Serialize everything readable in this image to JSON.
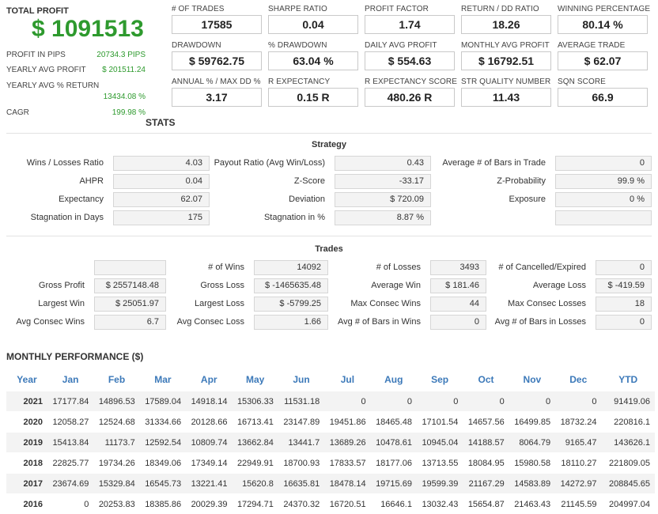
{
  "summary": {
    "total_profit_label": "TOTAL PROFIT",
    "total_profit_value": "$ 1091513",
    "rows": [
      {
        "label": "PROFIT IN PIPS",
        "value": "20734.3 PIPS"
      },
      {
        "label": "YEARLY AVG PROFIT",
        "value": "$ 201511.24"
      },
      {
        "label": "YEARLY AVG % RETURN",
        "value": "13434.08 %"
      },
      {
        "label": "CAGR",
        "value": "199.98 %"
      }
    ]
  },
  "metrics": [
    {
      "label": "# OF TRADES",
      "value": "17585"
    },
    {
      "label": "SHARPE RATIO",
      "value": "0.04"
    },
    {
      "label": "PROFIT FACTOR",
      "value": "1.74"
    },
    {
      "label": "RETURN / DD RATIO",
      "value": "18.26"
    },
    {
      "label": "WINNING PERCENTAGE",
      "value": "80.14 %"
    },
    {
      "label": "DRAWDOWN",
      "value": "$ 59762.75"
    },
    {
      "label": "% DRAWDOWN",
      "value": "63.04 %"
    },
    {
      "label": "DAILY AVG PROFIT",
      "value": "$ 554.63"
    },
    {
      "label": "MONTHLY AVG PROFIT",
      "value": "$ 16792.51"
    },
    {
      "label": "AVERAGE TRADE",
      "value": "$ 62.07"
    },
    {
      "label": "ANNUAL % / MAX DD %",
      "value": "3.17"
    },
    {
      "label": "R EXPECTANCY",
      "value": "0.15 R"
    },
    {
      "label": "R EXPECTANCY SCORE",
      "value": "480.26 R"
    },
    {
      "label": "STR QUALITY NUMBER",
      "value": "11.43"
    },
    {
      "label": "SQN SCORE",
      "value": "66.9"
    }
  ],
  "stats_title": "STATS",
  "strategy": {
    "title": "Strategy",
    "rows": [
      [
        {
          "label": "Wins / Losses Ratio",
          "value": "4.03"
        },
        {
          "label": "Payout Ratio (Avg Win/Loss)",
          "value": "0.43"
        },
        {
          "label": "Average # of Bars in Trade",
          "value": "0"
        }
      ],
      [
        {
          "label": "AHPR",
          "value": "0.04"
        },
        {
          "label": "Z-Score",
          "value": "-33.17"
        },
        {
          "label": "Z-Probability",
          "value": "99.9 %"
        }
      ],
      [
        {
          "label": "Expectancy",
          "value": "62.07"
        },
        {
          "label": "Deviation",
          "value": "$ 720.09"
        },
        {
          "label": "Exposure",
          "value": "0 %"
        }
      ],
      [
        {
          "label": "Stagnation in Days",
          "value": "175"
        },
        {
          "label": "Stagnation in %",
          "value": "8.87 %"
        },
        {
          "label": "",
          "value": ""
        }
      ]
    ]
  },
  "trades": {
    "title": "Trades",
    "rows": [
      [
        {
          "label": "",
          "value": ""
        },
        {
          "label": "# of Wins",
          "value": "14092"
        },
        {
          "label": "# of Losses",
          "value": "3493"
        },
        {
          "label": "# of Cancelled/Expired",
          "value": "0"
        }
      ],
      [
        {
          "label": "Gross Profit",
          "value": "$ 2557148.48"
        },
        {
          "label": "Gross Loss",
          "value": "$ -1465635.48"
        },
        {
          "label": "Average Win",
          "value": "$ 181.46"
        },
        {
          "label": "Average Loss",
          "value": "$ -419.59"
        }
      ],
      [
        {
          "label": "Largest Win",
          "value": "$ 25051.97"
        },
        {
          "label": "Largest Loss",
          "value": "$ -5799.25"
        },
        {
          "label": "Max Consec Wins",
          "value": "44"
        },
        {
          "label": "Max Consec Losses",
          "value": "18"
        }
      ],
      [
        {
          "label": "Avg Consec Wins",
          "value": "6.7"
        },
        {
          "label": "Avg Consec Loss",
          "value": "1.66"
        },
        {
          "label": "Avg # of Bars in Wins",
          "value": "0"
        },
        {
          "label": "Avg # of Bars in Losses",
          "value": "0"
        }
      ]
    ]
  },
  "monthly": {
    "title": "MONTHLY PERFORMANCE ($)",
    "headers": [
      "Year",
      "Jan",
      "Feb",
      "Mar",
      "Apr",
      "May",
      "Jun",
      "Jul",
      "Aug",
      "Sep",
      "Oct",
      "Nov",
      "Dec",
      "YTD"
    ],
    "rows": [
      [
        "2021",
        "17177.84",
        "14896.53",
        "17589.04",
        "14918.14",
        "15306.33",
        "11531.18",
        "0",
        "0",
        "0",
        "0",
        "0",
        "0",
        "91419.06"
      ],
      [
        "2020",
        "12058.27",
        "12524.68",
        "31334.66",
        "20128.66",
        "16713.41",
        "23147.89",
        "19451.86",
        "18465.48",
        "17101.54",
        "14657.56",
        "16499.85",
        "18732.24",
        "220816.1"
      ],
      [
        "2019",
        "15413.84",
        "11173.7",
        "12592.54",
        "10809.74",
        "13662.84",
        "13441.7",
        "13689.26",
        "10478.61",
        "10945.04",
        "14188.57",
        "8064.79",
        "9165.47",
        "143626.1"
      ],
      [
        "2018",
        "22825.77",
        "19734.26",
        "18349.06",
        "17349.14",
        "22949.91",
        "18700.93",
        "17833.57",
        "18177.06",
        "13713.55",
        "18084.95",
        "15980.58",
        "18110.27",
        "221809.05"
      ],
      [
        "2017",
        "23674.69",
        "15329.84",
        "16545.73",
        "13221.41",
        "15620.8",
        "16635.81",
        "18478.14",
        "19715.69",
        "19599.39",
        "21167.29",
        "14583.89",
        "14272.97",
        "208845.65"
      ],
      [
        "2016",
        "0",
        "20253.83",
        "18385.86",
        "20029.39",
        "17294.71",
        "24370.32",
        "16720.51",
        "16646.1",
        "13032.43",
        "15654.87",
        "21463.43",
        "21145.59",
        "204997.04"
      ]
    ]
  }
}
